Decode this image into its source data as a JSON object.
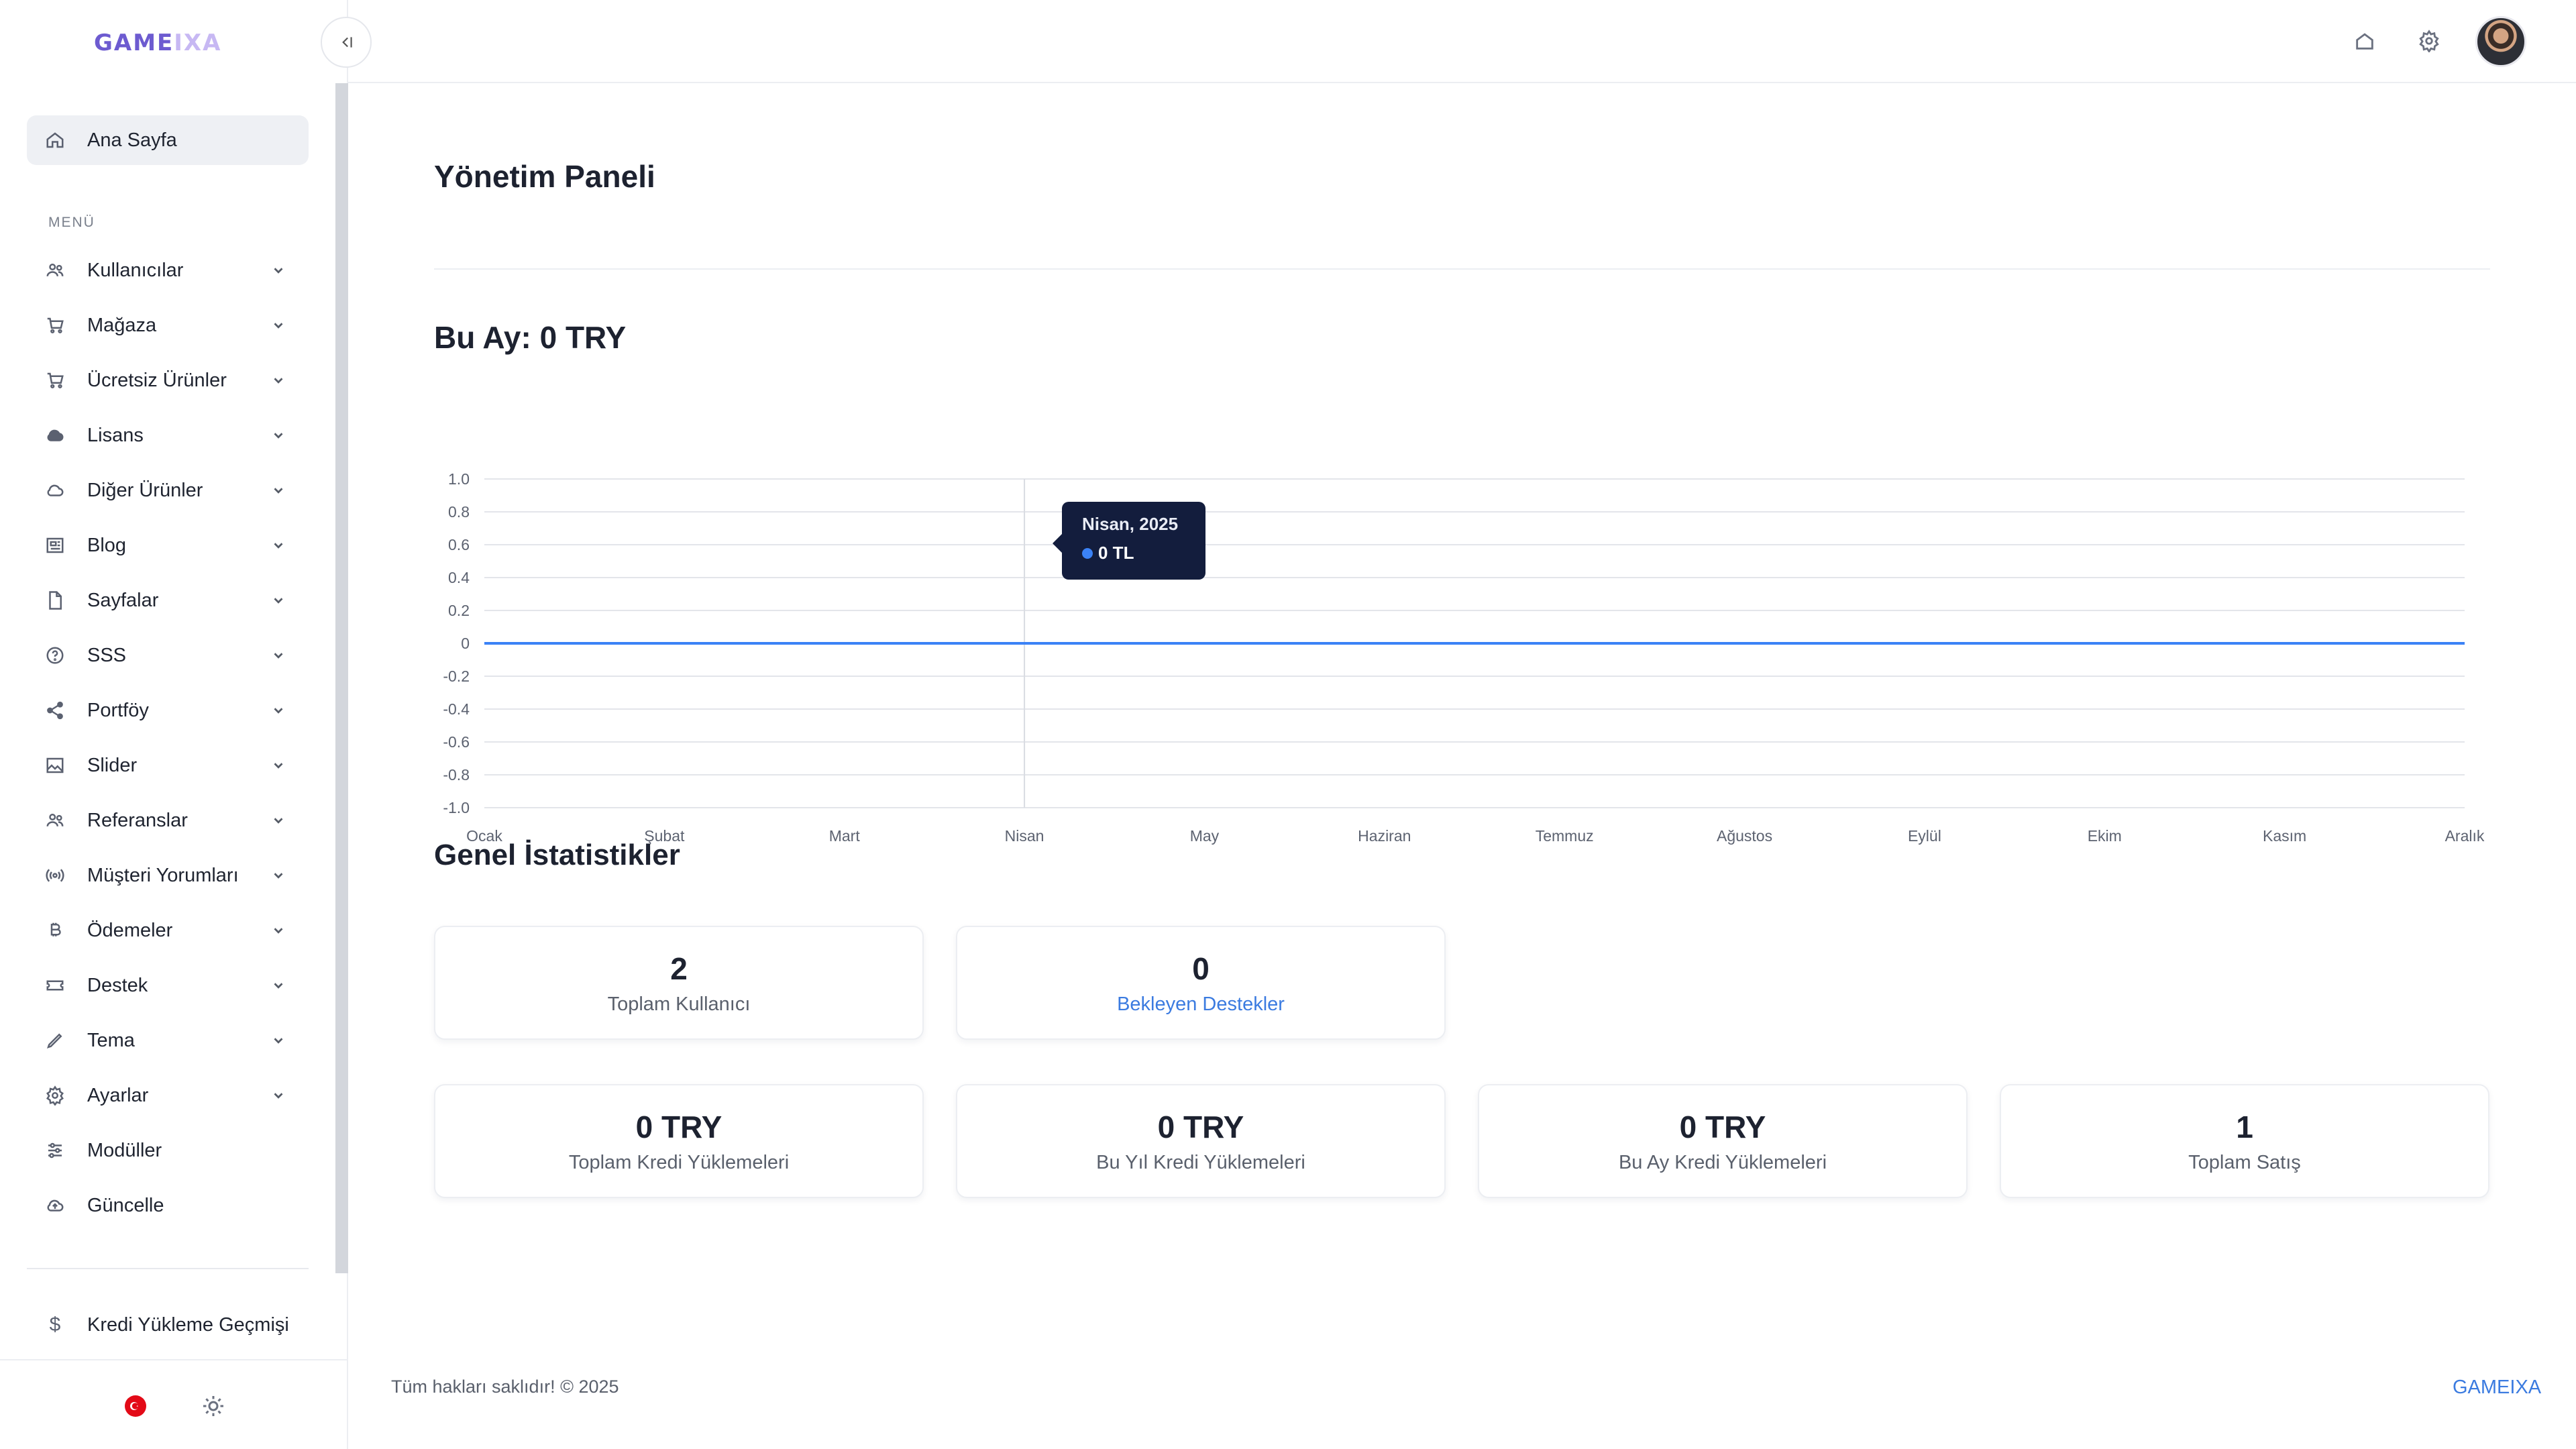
{
  "brand": {
    "logo_main": "GAME",
    "logo_faded": "IXA"
  },
  "sidebar": {
    "home_label": "Ana Sayfa",
    "menu_heading": "MENÜ",
    "items": [
      {
        "label": "Kullanıcılar",
        "icon": "users-icon"
      },
      {
        "label": "Mağaza",
        "icon": "cart-icon"
      },
      {
        "label": "Ücretsiz Ürünler",
        "icon": "cart-icon"
      },
      {
        "label": "Lisans",
        "icon": "cloud-solid-icon"
      },
      {
        "label": "Diğer Ürünler",
        "icon": "cloud-icon"
      },
      {
        "label": "Blog",
        "icon": "newspaper-icon"
      },
      {
        "label": "Sayfalar",
        "icon": "file-icon"
      },
      {
        "label": "SSS",
        "icon": "question-icon"
      },
      {
        "label": "Portföy",
        "icon": "share-icon"
      },
      {
        "label": "Slider",
        "icon": "image-icon"
      },
      {
        "label": "Referanslar",
        "icon": "users-icon"
      },
      {
        "label": "Müşteri Yorumları",
        "icon": "broadcast-icon"
      },
      {
        "label": "Ödemeler",
        "icon": "bitcoin-icon"
      },
      {
        "label": "Destek",
        "icon": "ticket-icon"
      },
      {
        "label": "Tema",
        "icon": "brush-icon"
      },
      {
        "label": "Ayarlar",
        "icon": "gear-icon"
      },
      {
        "label": "Modüller",
        "icon": "sliders-icon"
      },
      {
        "label": "Güncelle",
        "icon": "cloud-upload-icon"
      }
    ],
    "credit_history_label": "Kredi Yükleme Geçmişi",
    "credit_history_icon": "$"
  },
  "main": {
    "page_title": "Yönetim Paneli",
    "chart_title": "Bu Ay: 0 TRY",
    "tooltip": {
      "title": "Nisan, 2025",
      "value": "0 TL"
    },
    "stats_title": "Genel İstatistikler",
    "cards_row1": [
      {
        "value": "2",
        "label": "Toplam Kullanıcı"
      },
      {
        "value": "0",
        "label": "Bekleyen Destekler"
      }
    ],
    "cards_row2": [
      {
        "value": "0 TRY",
        "label": "Toplam Kredi Yüklemeleri"
      },
      {
        "value": "0 TRY",
        "label": "Bu Yıl Kredi Yüklemeleri"
      },
      {
        "value": "0 TRY",
        "label": "Bu Ay Kredi Yüklemeleri"
      },
      {
        "value": "1",
        "label": "Toplam Satış"
      }
    ]
  },
  "footer": {
    "copyright": "Tüm hakları saklıdır! © 2025",
    "brand": "GAMEIXA"
  },
  "colors": {
    "accent": "#3b82f6",
    "link": "#3b7be0",
    "tooltip_bg": "#131d3d",
    "logo": "#6d5bd0"
  },
  "chart_data": {
    "type": "line",
    "categories": [
      "Ocak",
      "Şubat",
      "Mart",
      "Nisan",
      "May",
      "Haziran",
      "Temmuz",
      "Ağustos",
      "Eylül",
      "Ekim",
      "Kasım",
      "Aralık"
    ],
    "series": [
      {
        "values": [
          0,
          0,
          0,
          0,
          0,
          0,
          0,
          0,
          0,
          0,
          0,
          0
        ]
      }
    ],
    "ylim": [
      -1.0,
      1.0
    ],
    "yticks": [
      "1.0",
      "0.8",
      "0.6",
      "0.4",
      "0.2",
      "0",
      "-0.2",
      "-0.4",
      "-0.6",
      "-0.8",
      "-1.0"
    ],
    "grid": true,
    "highlighted_category": "Nisan",
    "line_color": "#3b82f6"
  }
}
